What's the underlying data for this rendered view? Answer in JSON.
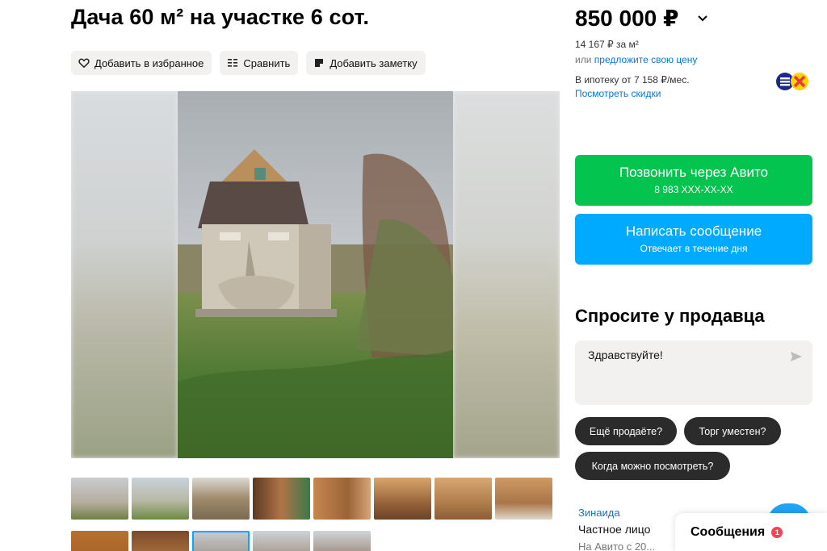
{
  "listing": {
    "title": "Дача 60 м² на участке 6 сот."
  },
  "actions": {
    "favorite_label": "Добавить в избранное",
    "compare_label": "Сравнить",
    "note_label": "Добавить заметку"
  },
  "pricing": {
    "price": "850 000 ₽",
    "per_m2": "14 167 ₽ за м²",
    "offer_prefix": "или",
    "offer_link": "предложите свою цену",
    "mortgage": "В ипотеку от 7 158 ₽/мес.",
    "discounts_link": "Посмотреть скидки"
  },
  "contact": {
    "call_label": "Позвонить через Авито",
    "call_phone": "8 983 XXX-XX-XX",
    "message_label": "Написать сообщение",
    "message_sub": "Отвечает в течение дня"
  },
  "ask": {
    "title": "Спросите у продавца",
    "input_value": "Здравствуйте!",
    "chips": [
      "Ещё продаёте?",
      "Торг уместен?",
      "Когда можно посмотреть?"
    ]
  },
  "seller": {
    "name": "Зинаида",
    "type": "Частное лицо",
    "extra": "На Авито с 20..."
  },
  "messages": {
    "label": "Сообщения",
    "badge": "1"
  },
  "colors": {
    "call_green": "#02c44e",
    "message_blue": "#00aaff",
    "link_blue": "#0a75d8",
    "badge_red": "#ff4053"
  }
}
